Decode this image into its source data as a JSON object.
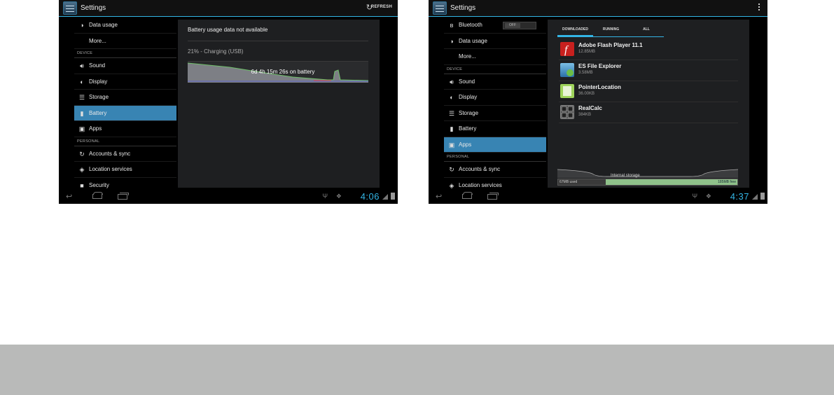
{
  "left_screen": {
    "app_title": "Settings",
    "refresh_label": "REFRESH",
    "sidebar": {
      "items_top": [
        {
          "label": "Data usage",
          "icon": "data-usage-icon"
        },
        {
          "label": "More...",
          "icon": ""
        }
      ],
      "header_device": "DEVICE",
      "items_device": [
        {
          "label": "Sound",
          "icon": "sound-icon"
        },
        {
          "label": "Display",
          "icon": "display-icon"
        },
        {
          "label": "Storage",
          "icon": "storage-icon"
        },
        {
          "label": "Battery",
          "icon": "battery-icon"
        },
        {
          "label": "Apps",
          "icon": "apps-icon"
        }
      ],
      "header_personal": "PERSONAL",
      "items_personal": [
        {
          "label": "Accounts & sync",
          "icon": "sync-icon"
        },
        {
          "label": "Location services",
          "icon": "location-icon"
        },
        {
          "label": "Security",
          "icon": "lock-icon"
        }
      ]
    },
    "battery": {
      "status_message": "Battery usage data not available",
      "charge_status": "21% - Charging (USB)",
      "graph_label": "6d 4h 15m 26s on battery"
    },
    "clock": "4:06"
  },
  "right_screen": {
    "app_title": "Settings",
    "sidebar": {
      "items_top": [
        {
          "label": "Bluetooth",
          "icon": "bluetooth-icon",
          "toggle": "OFF"
        },
        {
          "label": "Data usage",
          "icon": "data-usage-icon"
        },
        {
          "label": "More...",
          "icon": ""
        }
      ],
      "header_device": "DEVICE",
      "items_device": [
        {
          "label": "Sound",
          "icon": "sound-icon"
        },
        {
          "label": "Display",
          "icon": "display-icon"
        },
        {
          "label": "Storage",
          "icon": "storage-icon"
        },
        {
          "label": "Battery",
          "icon": "battery-icon"
        },
        {
          "label": "Apps",
          "icon": "apps-icon"
        }
      ],
      "header_personal": "PERSONAL",
      "items_personal": [
        {
          "label": "Accounts & sync",
          "icon": "sync-icon"
        },
        {
          "label": "Location services",
          "icon": "location-icon"
        }
      ]
    },
    "tabs": [
      "DOWNLOADED",
      "RUNNING",
      "ALL"
    ],
    "apps": [
      {
        "name": "Adobe Flash Player 11.1",
        "size": "12.85MB"
      },
      {
        "name": "ES File Explorer",
        "size": "3.58MB"
      },
      {
        "name": "PointerLocation",
        "size": "36.00KB"
      },
      {
        "name": "RealCalc",
        "size": "384KB"
      }
    ],
    "storage": {
      "label": "Internal storage",
      "used": "67MB used",
      "free": "185MB free"
    },
    "clock": "4:37"
  },
  "colors": {
    "accent": "#33b5e5",
    "selected": "#3884b3",
    "footer_band": "#b9bab9"
  }
}
